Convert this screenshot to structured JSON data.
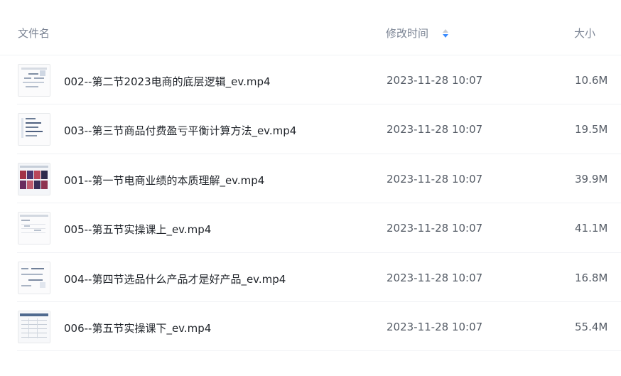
{
  "header": {
    "name_label": "文件名",
    "time_label": "修改时间",
    "size_label": "大小",
    "sort_icon": "sort-icon",
    "sort_color": "#3b8cff"
  },
  "files": [
    {
      "name": "002--第二节2023电商的底层逻辑_ev.mp4",
      "time": "2023-11-28 10:07",
      "size": "10.6M",
      "thumb_icon": "video-thumbnail"
    },
    {
      "name": "003--第三节商品付费盈亏平衡计算方法_ev.mp4",
      "time": "2023-11-28 10:07",
      "size": "19.5M",
      "thumb_icon": "video-thumbnail"
    },
    {
      "name": "001--第一节电商业绩的本质理解_ev.mp4",
      "time": "2023-11-28 10:07",
      "size": "39.9M",
      "thumb_icon": "video-thumbnail"
    },
    {
      "name": "005--第五节实操课上_ev.mp4",
      "time": "2023-11-28 10:07",
      "size": "41.1M",
      "thumb_icon": "video-thumbnail"
    },
    {
      "name": "004--第四节选品什么产品才是好产品_ev.mp4",
      "time": "2023-11-28 10:07",
      "size": "16.8M",
      "thumb_icon": "video-thumbnail"
    },
    {
      "name": "006--第五节实操课下_ev.mp4",
      "time": "2023-11-28 10:07",
      "size": "55.4M",
      "thumb_icon": "video-thumbnail"
    }
  ]
}
